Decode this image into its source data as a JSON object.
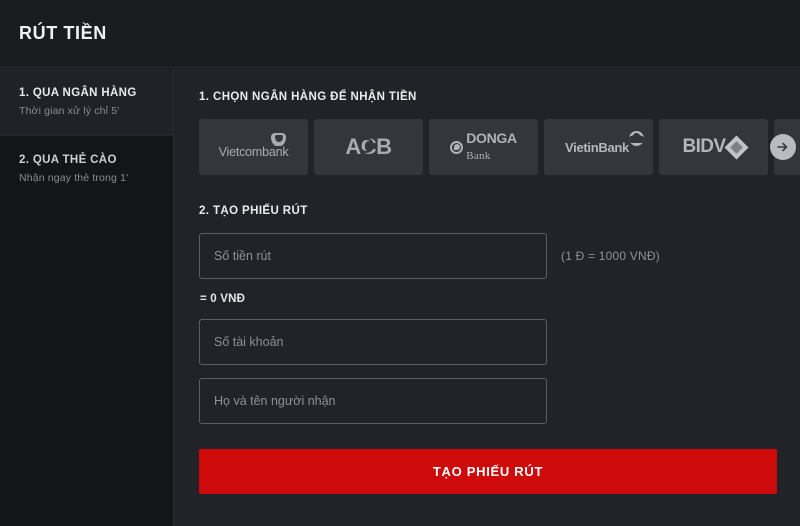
{
  "header": {
    "title": "RÚT TIỀN"
  },
  "sidebar": {
    "items": [
      {
        "title": "1. QUA NGÂN HÀNG",
        "subtitle": "Thời gian xử lý chỉ 5'",
        "active": true
      },
      {
        "title": "2. QUA THẺ CÀO",
        "subtitle": "Nhận ngay thẻ trong 1'",
        "active": false
      }
    ]
  },
  "main": {
    "step1_label": "1. CHỌN NGÂN HÀNG ĐỂ NHẬN TIỀN",
    "step2_label": "2. TẠO PHIẾU RÚT",
    "banks": [
      {
        "name": "Vietcombank",
        "logo_kind": "vietcombank-logo"
      },
      {
        "name": "ACB",
        "logo_kind": "acb-logo"
      },
      {
        "name": "DONGA Bank",
        "logo_line1": "DONGA",
        "logo_line2": "Bank",
        "logo_kind": "donga-logo"
      },
      {
        "name": "VietinBank",
        "logo_kind": "vietinbank-logo"
      },
      {
        "name": "BIDV",
        "logo_kind": "bidv-logo"
      }
    ],
    "next_banks_icon": "arrow-right-icon",
    "form": {
      "amount_placeholder": "Số tiền rút",
      "amount_value": "",
      "rate_hint": "(1 Đ = 1000 VNĐ)",
      "converted_amount": "= 0 VNĐ",
      "account_placeholder": "Số tài khoản",
      "account_value": "",
      "name_placeholder": "Họ và tên người nhận",
      "name_value": "",
      "submit_label": "TẠO PHIẾU RÚT"
    }
  },
  "colors": {
    "accent_red": "#cf0a0a",
    "page_bg": "#1b1c20",
    "sidebar_bg": "#141518",
    "content_bg": "#222328",
    "tile_bg": "#34363c"
  }
}
